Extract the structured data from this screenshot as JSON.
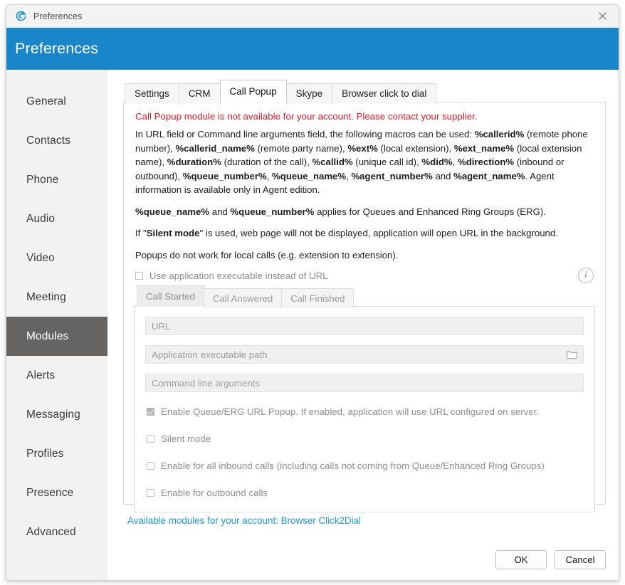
{
  "window": {
    "titlebar_text": "Preferences",
    "app_icon": "app-logo-icon",
    "close_icon": "close-icon"
  },
  "header": {
    "title": "Preferences",
    "accent_color": "#1886c8"
  },
  "sidebar": {
    "active": "Modules",
    "active_bg": "#666462",
    "items": [
      {
        "label": "General"
      },
      {
        "label": "Contacts"
      },
      {
        "label": "Phone"
      },
      {
        "label": "Audio"
      },
      {
        "label": "Video"
      },
      {
        "label": "Meeting"
      },
      {
        "label": "Modules"
      },
      {
        "label": "Alerts"
      },
      {
        "label": "Messaging"
      },
      {
        "label": "Profiles"
      },
      {
        "label": "Presence"
      },
      {
        "label": "Advanced"
      }
    ]
  },
  "tabs": {
    "active": "Call Popup",
    "items": [
      {
        "label": "Settings"
      },
      {
        "label": "CRM"
      },
      {
        "label": "Call Popup"
      },
      {
        "label": "Skype"
      },
      {
        "label": "Browser click to dial"
      }
    ]
  },
  "content": {
    "warning": "Call Popup module is not available for your account. Please contact your supplier.",
    "warning_color": "#e8192c",
    "paragraph1_parts": [
      {
        "text": "In URL field or Command line arguments field, the following macros can be used: ",
        "bold": false
      },
      {
        "text": "%callerid%",
        "bold": true
      },
      {
        "text": " (remote phone number), ",
        "bold": false
      },
      {
        "text": "%callerid_name%",
        "bold": true
      },
      {
        "text": " (remote party name), ",
        "bold": false
      },
      {
        "text": "%ext%",
        "bold": true
      },
      {
        "text": " (local extension), ",
        "bold": false
      },
      {
        "text": "%ext_name%",
        "bold": true
      },
      {
        "text": " (local extension name), ",
        "bold": false
      },
      {
        "text": "%duration%",
        "bold": true
      },
      {
        "text": " (duration of the call), ",
        "bold": false
      },
      {
        "text": "%callid%",
        "bold": true
      },
      {
        "text": " (unique call id), ",
        "bold": false
      },
      {
        "text": "%did%",
        "bold": true
      },
      {
        "text": ", ",
        "bold": false
      },
      {
        "text": "%direction%",
        "bold": true
      },
      {
        "text": " (inbound or outbound), ",
        "bold": false
      },
      {
        "text": "%queue_number%",
        "bold": true
      },
      {
        "text": ", ",
        "bold": false
      },
      {
        "text": "%queue_name%",
        "bold": true
      },
      {
        "text": ", ",
        "bold": false
      },
      {
        "text": "%agent_number%",
        "bold": true
      },
      {
        "text": " and ",
        "bold": false
      },
      {
        "text": "%agent_name%",
        "bold": true
      },
      {
        "text": ". Agent information is available only in Agent edition.",
        "bold": false
      }
    ],
    "paragraph2_parts": [
      {
        "text": "%queue_name%",
        "bold": true
      },
      {
        "text": " and ",
        "bold": false
      },
      {
        "text": "%queue_number%",
        "bold": true
      },
      {
        "text": " applies for Queues and Enhanced Ring Groups (ERG).",
        "bold": false
      }
    ],
    "paragraph3_parts": [
      {
        "text": "If \"",
        "bold": false
      },
      {
        "text": "Silent mode",
        "bold": true
      },
      {
        "text": "\" is used, web page will not be displayed, application will open URL in the background.",
        "bold": false
      }
    ],
    "paragraph4_parts": [
      {
        "text": "Popups do not work for local calls (e.g. extension to extension).",
        "bold": false
      }
    ],
    "use_executable": {
      "label": "Use application executable instead of URL",
      "checked": false
    },
    "info_icon_glyph": "i"
  },
  "inner_tabs": {
    "active": "Call Started",
    "items": [
      {
        "label": "Call Started"
      },
      {
        "label": "Call Answered"
      },
      {
        "label": "Call Finished"
      }
    ]
  },
  "fields": {
    "url": {
      "placeholder": "URL",
      "value": ""
    },
    "app_path": {
      "placeholder": "Application executable path",
      "value": "",
      "browse_icon": "folder-icon"
    },
    "cmd_args": {
      "placeholder": "Command line arguments",
      "value": ""
    }
  },
  "options": [
    {
      "label": "Enable Queue/ERG URL Popup. If enabled, application will use URL configured on server.",
      "checked": true
    },
    {
      "label": "Silent mode",
      "checked": false
    },
    {
      "label": "Enable for all inbound calls (including calls not coming from Queue/Enhanced Ring Groups)",
      "checked": false
    },
    {
      "label": "Enable for outbound calls",
      "checked": false
    }
  ],
  "footer": {
    "modules_link": "Available modules for your account: Browser Click2Dial",
    "link_color": "#2196d6",
    "ok_label": "OK",
    "cancel_label": "Cancel"
  }
}
